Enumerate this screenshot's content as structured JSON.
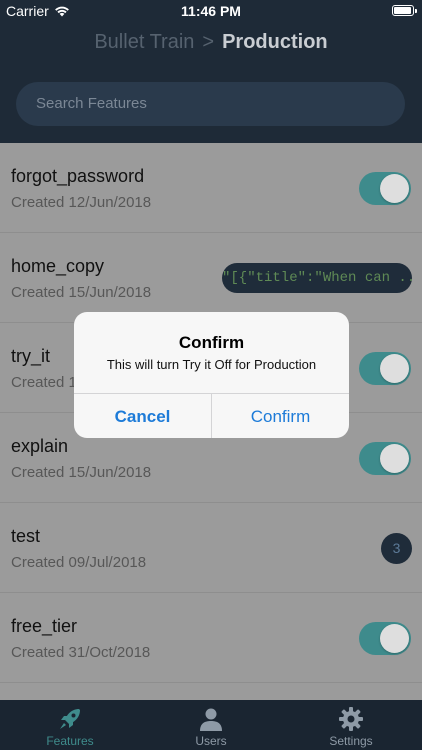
{
  "status_bar": {
    "carrier": "Carrier",
    "time": "11:46 PM",
    "battery_level": 0.95
  },
  "header": {
    "parent": "Bullet Train",
    "separator": ">",
    "current": "Production"
  },
  "search": {
    "placeholder": "Search Features"
  },
  "features": [
    {
      "name": "forgot_password",
      "created": "Created 12/Jun/2018",
      "control": "toggle",
      "enabled": true
    },
    {
      "name": "home_copy",
      "created": "Created 15/Jun/2018",
      "control": "value",
      "value": "\"[{\"title\":\"When can ...\""
    },
    {
      "name": "try_it",
      "created": "Created 1",
      "control": "toggle",
      "enabled": true
    },
    {
      "name": "explain",
      "created": "Created 15/Jun/2018",
      "control": "toggle",
      "enabled": true
    },
    {
      "name": "test",
      "created": "Created 09/Jul/2018",
      "control": "count",
      "value": "3"
    },
    {
      "name": "free_tier",
      "created": "Created 31/Oct/2018",
      "control": "toggle",
      "enabled": true
    }
  ],
  "dialog": {
    "title": "Confirm",
    "message": "This will turn Try it Off for Production",
    "cancel_label": "Cancel",
    "confirm_label": "Confirm"
  },
  "tabs": [
    {
      "label": "Features",
      "icon": "rocket-icon",
      "active": true
    },
    {
      "label": "Users",
      "icon": "user-icon",
      "active": false
    },
    {
      "label": "Settings",
      "icon": "gear-icon",
      "active": false
    }
  ],
  "colors": {
    "header_bg": "#1e2a37",
    "accent": "#3e8b8c",
    "link_blue": "#1d7bd8"
  }
}
